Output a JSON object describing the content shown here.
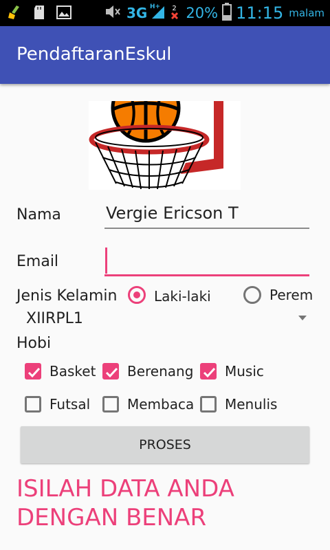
{
  "status_bar": {
    "network": "3G",
    "network_sup": "H+",
    "sim_badge": "2",
    "battery": "20%",
    "time": "11:15",
    "ampm": "malam"
  },
  "app_bar": {
    "title": "PendaftaranEskul"
  },
  "form": {
    "nama_label": "Nama",
    "nama_value": "Vergie Ericson T",
    "email_label": "Email",
    "email_value": "",
    "jenis_kelamin_label": "Jenis Kelamin",
    "gender_options": [
      {
        "label": "Laki-laki",
        "checked": true
      },
      {
        "label": "Perem",
        "checked": false
      }
    ],
    "kelas_selected": "XIIRPL1",
    "hobi_label": "Hobi",
    "hobi_options": [
      {
        "label": "Basket",
        "checked": true
      },
      {
        "label": "Berenang",
        "checked": true
      },
      {
        "label": "Music",
        "checked": true
      },
      {
        "label": "Futsal",
        "checked": false
      },
      {
        "label": "Membaca",
        "checked": false
      },
      {
        "label": "Menulis",
        "checked": false
      }
    ],
    "submit_label": "PROSES"
  },
  "message": "ISILAH DATA ANDA DENGAN BENAR",
  "colors": {
    "primary": "#3f51b5",
    "accent": "#ec407a",
    "button": "#d6d7d7"
  }
}
